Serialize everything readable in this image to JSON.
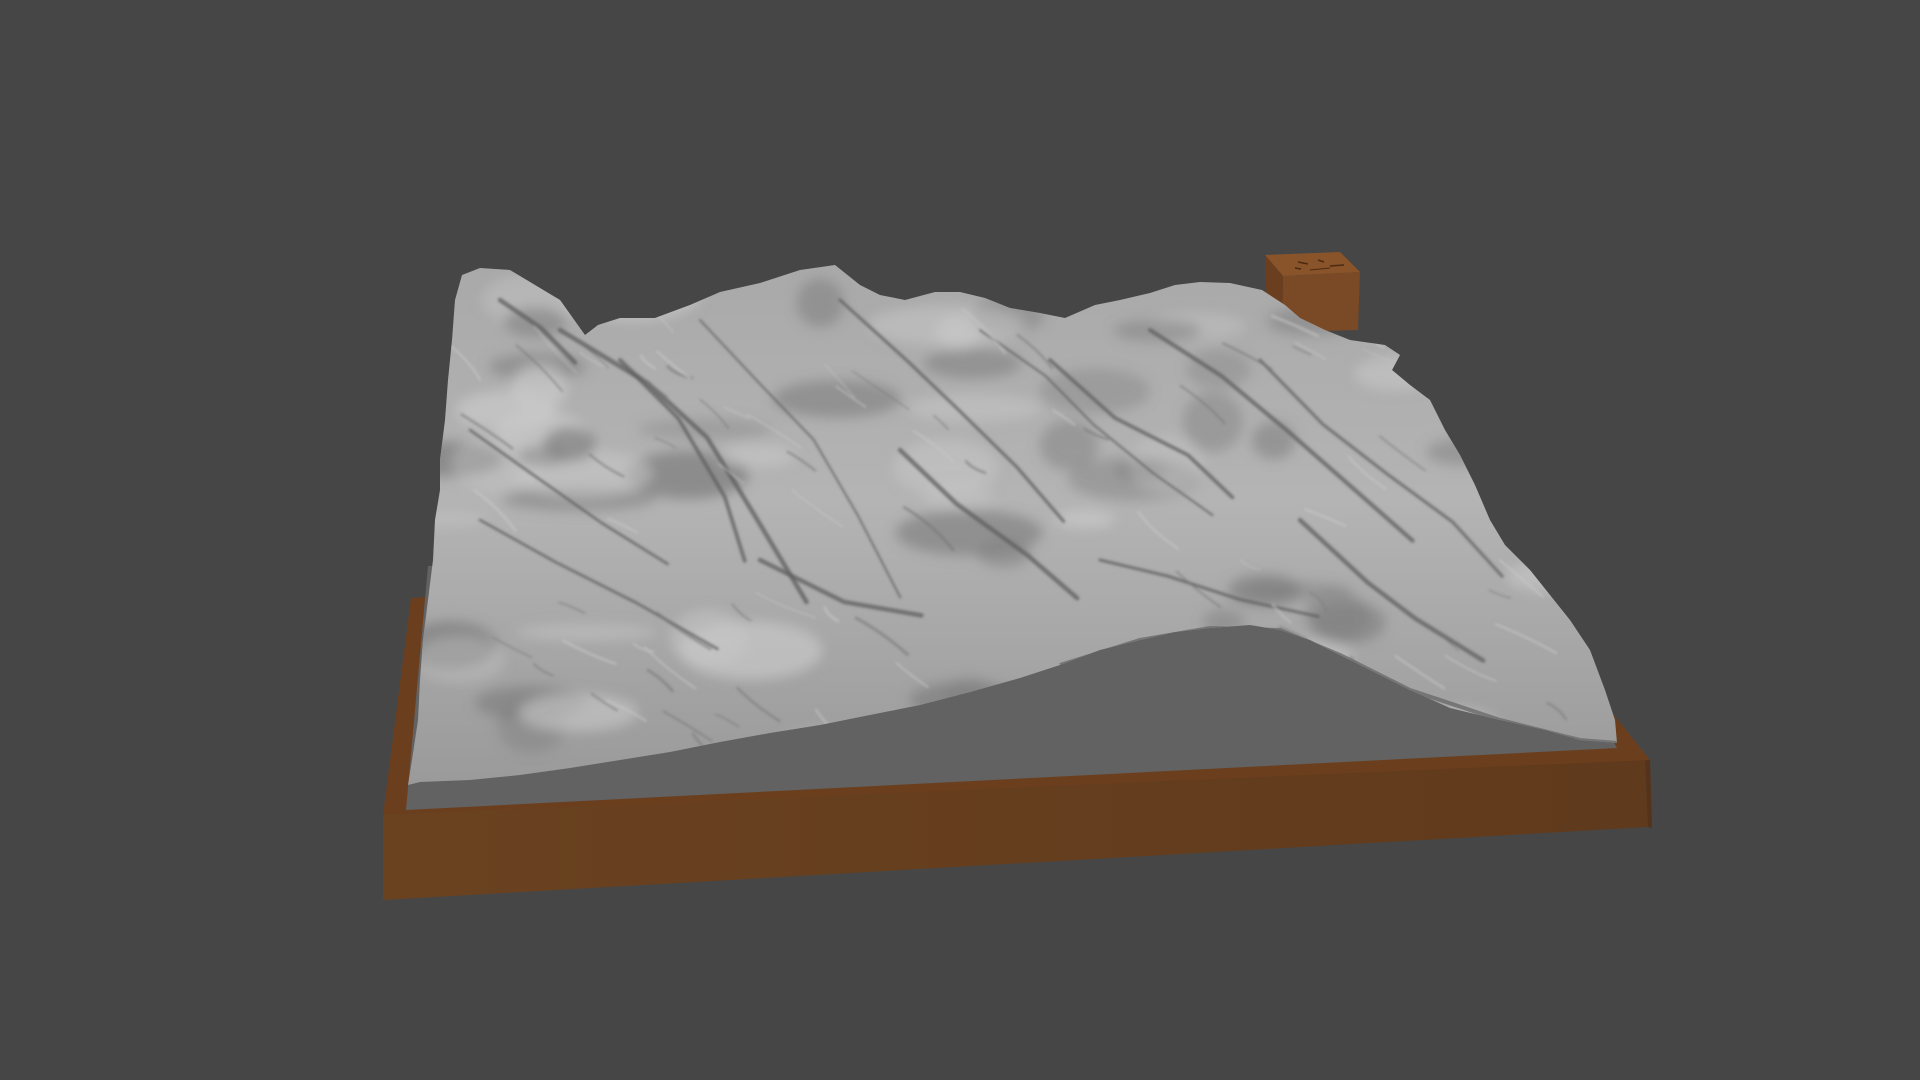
{
  "scene": {
    "background_color": "#464646",
    "subject": "terrain-relief-model",
    "colors": {
      "base_top": "#6a3f1f",
      "base_front": "#66401f",
      "base_right": "#5b3619",
      "plate_flat": "#626262",
      "terrain_light": "#b9b9b9",
      "terrain_mid": "#a0a0a0",
      "terrain_dark": "#737373",
      "ridge_line": "#5f5f5f",
      "block": "#7a4a26"
    },
    "elements": [
      {
        "name": "wooden-base",
        "kind": "box"
      },
      {
        "name": "flat-plate",
        "kind": "plane"
      },
      {
        "name": "terrain-mesh",
        "kind": "relief"
      },
      {
        "name": "corner-block",
        "kind": "box"
      }
    ]
  }
}
